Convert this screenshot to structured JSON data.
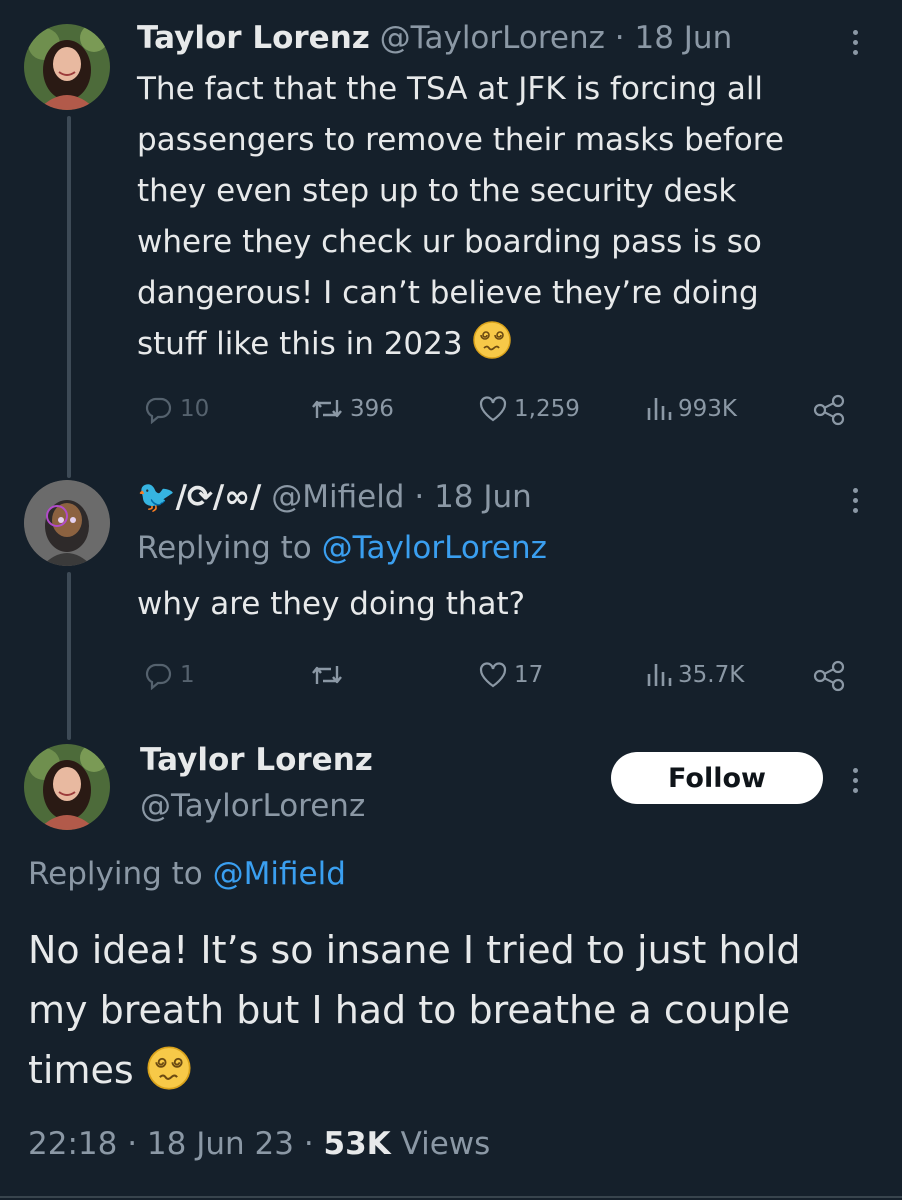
{
  "tweet1": {
    "author_name": "Taylor Lorenz",
    "handle": "@TaylorLorenz",
    "separator": "·",
    "date": "18 Jun",
    "text_lines": [
      "The fact that the TSA at JFK is forcing all",
      "passengers to remove their masks before",
      "they even step up to the security desk",
      "where they check ur boarding pass is so",
      "dangerous! I can’t believe they’re doing",
      "stuff like this in 2023"
    ],
    "emoji": "dizzy-face",
    "stats": {
      "replies": "10",
      "reposts": "396",
      "likes": "1,259",
      "views": "993K"
    }
  },
  "tweet2": {
    "author_name": "🐦/⟳/∞/",
    "handle": "@Mifield",
    "separator": "·",
    "date": "18 Jun",
    "replying_prefix": "Replying to",
    "replying_to": "@TaylorLorenz",
    "text": "why are they doing that?",
    "stats": {
      "replies": "1",
      "reposts": "",
      "likes": "17",
      "views": "35.7K"
    }
  },
  "tweet3": {
    "author_name": "Taylor Lorenz",
    "handle": "@TaylorLorenz",
    "follow_label": "Follow",
    "replying_prefix": "Replying to",
    "replying_to": "@Mifield",
    "text_lines": [
      "No idea! It’s so insane I tried to just hold",
      "my breath but I had to breathe a couple",
      "times"
    ],
    "emoji": "dizzy-face",
    "time": "22:18",
    "separator": "·",
    "date": "18 Jun 23",
    "views_count": "53K",
    "views_label": "Views"
  },
  "colors": {
    "background": "#15202b",
    "text": "#e7e9ea",
    "muted": "#8b98a5",
    "link": "#3a9ff0"
  }
}
